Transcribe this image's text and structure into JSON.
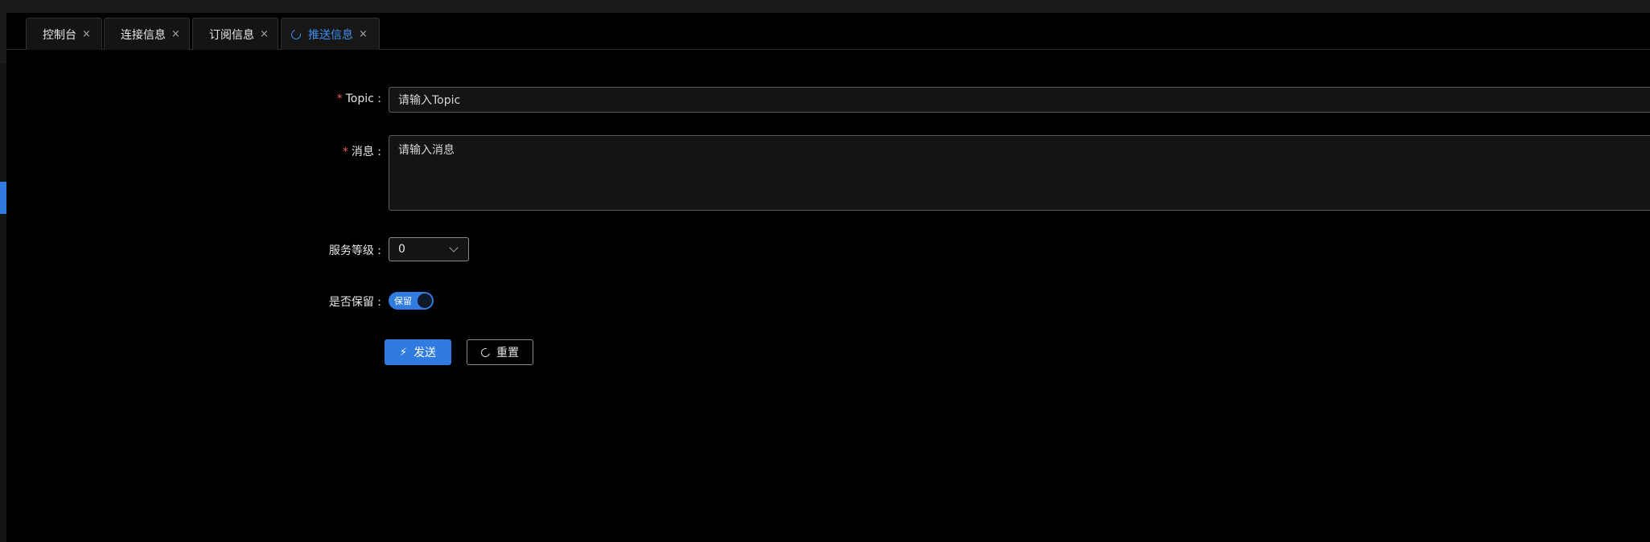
{
  "tabs": [
    {
      "label": "控制台",
      "close": "×"
    },
    {
      "label": "连接信息",
      "close": "×"
    },
    {
      "label": "订阅信息",
      "close": "×"
    },
    {
      "label": "推送信息",
      "close": "×",
      "active": true
    }
  ],
  "form": {
    "topic": {
      "required_mark": "*",
      "label": "Topic :",
      "placeholder": "请输入Topic"
    },
    "message": {
      "required_mark": "*",
      "label": "消息 :",
      "placeholder": "请输入消息"
    },
    "qos": {
      "label": "服务等级 :",
      "value": "0"
    },
    "retain": {
      "label": "是否保留 :",
      "switch_text": "保留",
      "on": true
    }
  },
  "buttons": {
    "send": {
      "label": "发送",
      "icon": "lightning-icon"
    },
    "reset": {
      "label": "重置",
      "icon": "refresh-icon"
    }
  },
  "colors": {
    "accent": "#2f7be0",
    "required": "#e85b5b",
    "background": "#000000"
  }
}
